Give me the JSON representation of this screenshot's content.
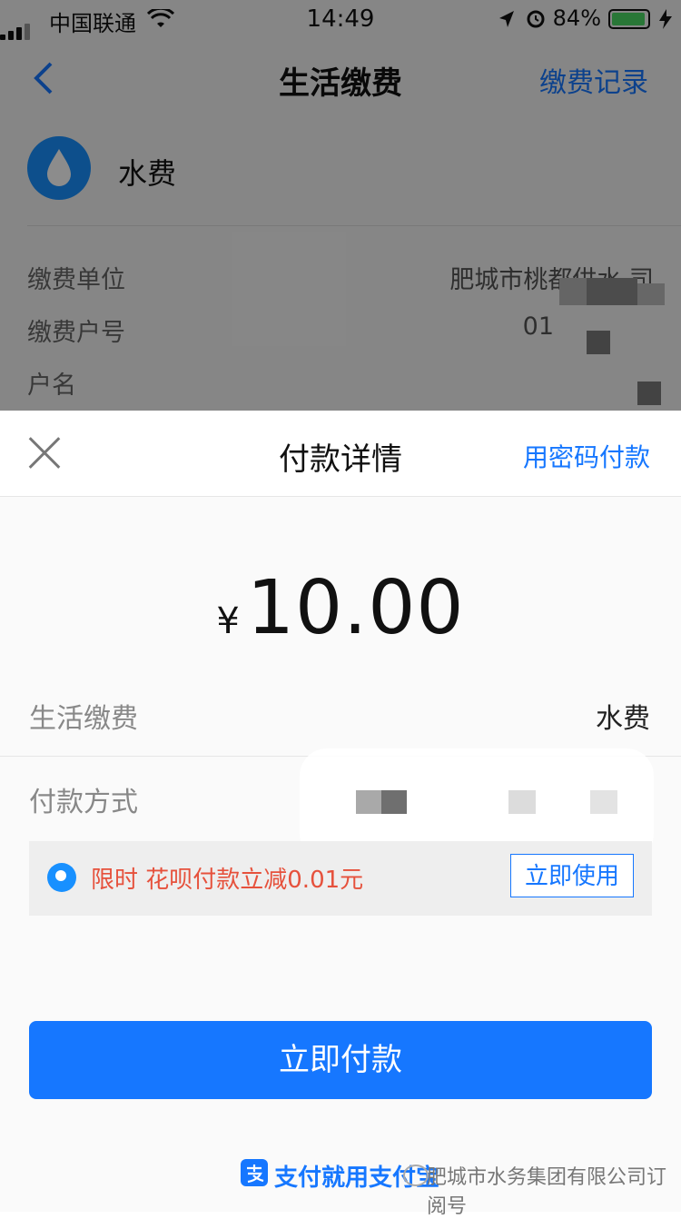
{
  "status_bar": {
    "carrier": "中国联通",
    "time": "14:49",
    "battery": "84%"
  },
  "nav": {
    "title": "生活缴费",
    "right_link": "缴费记录"
  },
  "service": {
    "name": "水费"
  },
  "info_rows": [
    {
      "label": "缴费单位",
      "value": "肥城市桃都供水        司"
    },
    {
      "label": "缴费户号",
      "value": "01"
    },
    {
      "label": "户名",
      "value": ""
    }
  ],
  "sheet": {
    "title": "付款详情",
    "password_pay": "用密码付款",
    "currency_symbol": "¥",
    "amount": "10.00",
    "rows": [
      {
        "label": "生活缴费",
        "value": "水费"
      },
      {
        "label": "付款方式",
        "value": ""
      }
    ],
    "promo": {
      "text": "限时 花呗付款立减0.01元",
      "button": "立即使用"
    },
    "pay_button": "立即付款",
    "footer_slogan": "支付就用支付宝",
    "watermark": "肥城市水务集团有限公司订阅号"
  },
  "colors": {
    "accent": "#1677ff",
    "promo_red": "#e6513c"
  }
}
